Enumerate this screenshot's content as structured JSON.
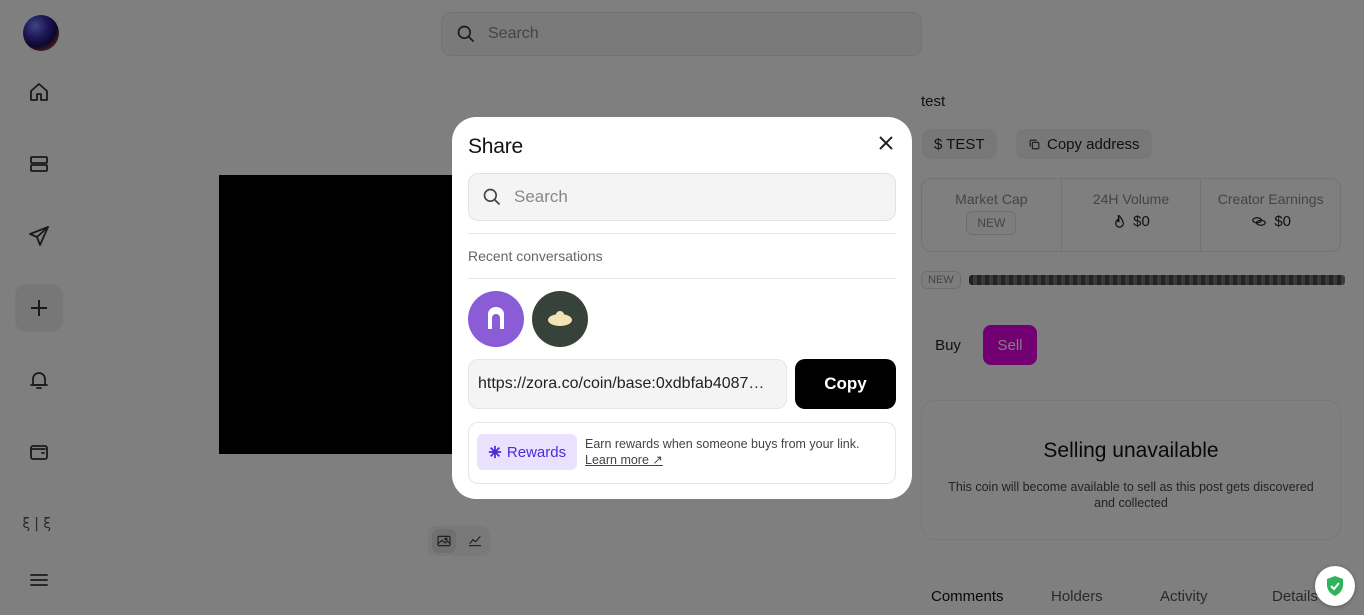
{
  "sidebar": {
    "items": [
      {
        "name": "home-icon"
      },
      {
        "name": "feed-icon"
      },
      {
        "name": "send-icon"
      },
      {
        "name": "create-icon"
      },
      {
        "name": "bell-icon"
      },
      {
        "name": "wallet-icon"
      }
    ],
    "text_icon": "ξ|ξ",
    "menu_icon": "menu-icon"
  },
  "top_search": {
    "placeholder": "Search"
  },
  "coin": {
    "name": "test",
    "ticker": "$ TEST",
    "copy_address": "Copy address",
    "stats": {
      "market_cap_label": "Market Cap",
      "market_cap_value": "NEW",
      "volume_label": "24H Volume",
      "volume_value": "$0",
      "earnings_label": "Creator Earnings",
      "earnings_value": "$0"
    },
    "progress_badge": "NEW",
    "buy_label": "Buy",
    "sell_label": "Sell",
    "sell_title": "Selling unavailable",
    "sell_desc": "This coin will become available to sell as this post gets discovered and collected",
    "tabs": [
      "Comments",
      "Holders",
      "Activity",
      "Details"
    ]
  },
  "modal": {
    "title": "Share",
    "search_placeholder": "Search",
    "recent_label": "Recent conversations",
    "conversations": [
      {
        "name": "conversation-1",
        "color": "#8a5cd6"
      },
      {
        "name": "conversation-2",
        "color": "#37433a"
      }
    ],
    "share_link": "https://zora.co/coin/base:0xdbfab4087…",
    "copy_label": "Copy",
    "rewards_badge": "Rewards",
    "rewards_text": "Earn rewards when someone buys from your link.",
    "learn_more": "Learn more"
  },
  "colors": {
    "sell_accent": "#e600e6",
    "rewards_accent": "#4b2bd6",
    "shield_green": "#2eb45a"
  }
}
